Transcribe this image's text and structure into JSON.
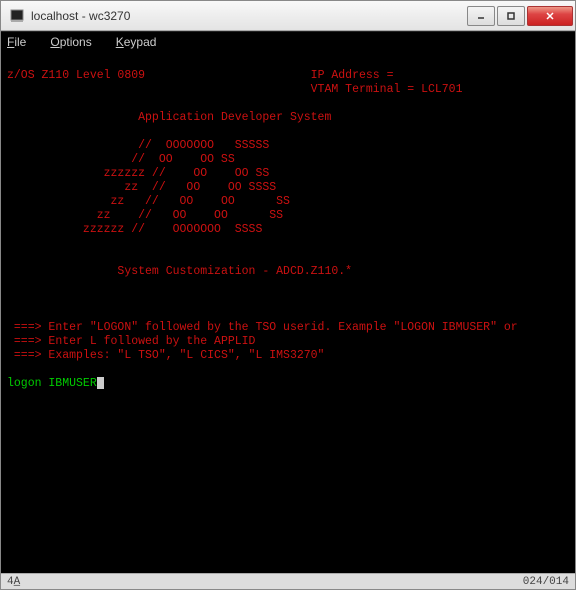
{
  "window": {
    "title": "localhost - wc3270"
  },
  "menubar": {
    "file": "File",
    "options": "Options",
    "keypad": "Keypad"
  },
  "terminal": {
    "line1_left": "z/OS Z110 Level 0809",
    "line1_right": "IP Address =         ",
    "line2_right": "VTAM Terminal = LCL701",
    "heading": "Application Developer System",
    "art1": "                   //  OOOOOOO   SSSSS ",
    "art2": "                  //  OO    OO SS      ",
    "art3": "    zzzzzz //    OO    OO SS           ",
    "art4": "       zz  //   OO    OO SSSS          ",
    "art5": "     zz   //   OO    OO      SS        ",
    "art6": "   zz    //   OO    OO      SS         ",
    "art7": " zzzzzz //    OOOOOOO  SSSS            ",
    "subheading": "System Customization - ADCD.Z110.*",
    "instr1": "===> Enter \"LOGON\" followed by the TSO userid. Example \"LOGON IBMUSER\" or",
    "instr2": "===> Enter L followed by the APPLID",
    "instr3": "===> Examples: \"L TSO\", \"L CICS\", \"L IMS3270\"",
    "input": "logon IBMUSER"
  },
  "status": {
    "left": "4A̲",
    "right": "024/014"
  }
}
